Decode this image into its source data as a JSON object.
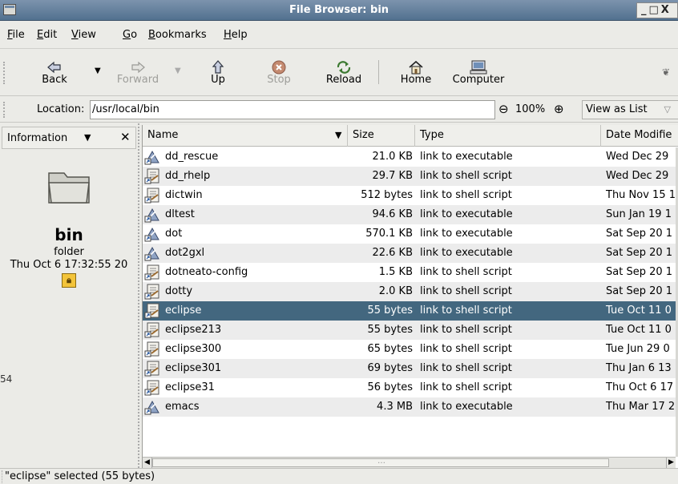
{
  "window": {
    "title": "File Browser: bin",
    "controls": "_□X"
  },
  "menu": [
    {
      "label": "File",
      "key": "F",
      "rest": "ile"
    },
    {
      "label": "Edit",
      "key": "E",
      "rest": "dit"
    },
    {
      "label": "View",
      "key": "V",
      "rest": "iew"
    },
    {
      "label": "Go",
      "key": "G",
      "rest": "o"
    },
    {
      "label": "Bookmarks",
      "key": "B",
      "rest": "ookmarks"
    },
    {
      "label": "Help",
      "key": "H",
      "rest": "elp"
    }
  ],
  "toolbar": {
    "back": {
      "label": "Back",
      "icon": "back-arrow-icon",
      "enabled": true
    },
    "forward": {
      "label": "Forward",
      "icon": "forward-arrow-icon",
      "enabled": false
    },
    "up": {
      "label": "Up",
      "icon": "up-arrow-icon",
      "enabled": true
    },
    "stop": {
      "label": "Stop",
      "icon": "stop-icon",
      "enabled": false
    },
    "reload": {
      "label": "Reload",
      "icon": "reload-icon",
      "enabled": true
    },
    "home": {
      "label": "Home",
      "icon": "home-icon",
      "enabled": true
    },
    "computer": {
      "label": "Computer",
      "icon": "computer-icon",
      "enabled": true
    }
  },
  "location": {
    "label": "Location:",
    "value": "/usr/local/bin",
    "zoom": "100%",
    "view_as": "View as List"
  },
  "side_pane": {
    "title": "Information",
    "name": "bin",
    "kind": "folder",
    "date": "Thu Oct  6 17:32:55 20",
    "stray": "54"
  },
  "columns": {
    "name": "Name",
    "size": "Size",
    "type": "Type",
    "date": "Date Modifie"
  },
  "files": [
    {
      "name": "dd_rescue",
      "size": "21.0 KB",
      "type": "link to executable",
      "date": "Wed Dec 29",
      "kind": "exec"
    },
    {
      "name": "dd_rhelp",
      "size": "29.7 KB",
      "type": "link to shell script",
      "date": "Wed Dec 29",
      "kind": "script"
    },
    {
      "name": "dictwin",
      "size": "512 bytes",
      "type": "link to shell script",
      "date": "Thu Nov 15 1",
      "kind": "script"
    },
    {
      "name": "dltest",
      "size": "94.6 KB",
      "type": "link to executable",
      "date": "Sun Jan 19 1",
      "kind": "exec"
    },
    {
      "name": "dot",
      "size": "570.1 KB",
      "type": "link to executable",
      "date": "Sat Sep 20 1",
      "kind": "exec"
    },
    {
      "name": "dot2gxl",
      "size": "22.6 KB",
      "type": "link to executable",
      "date": "Sat Sep 20 1",
      "kind": "exec"
    },
    {
      "name": "dotneato-config",
      "size": "1.5 KB",
      "type": "link to shell script",
      "date": "Sat Sep 20 1",
      "kind": "script"
    },
    {
      "name": "dotty",
      "size": "2.0 KB",
      "type": "link to shell script",
      "date": "Sat Sep 20 1",
      "kind": "script"
    },
    {
      "name": "eclipse",
      "size": "55 bytes",
      "type": "link to shell script",
      "date": "Tue Oct 11 0",
      "kind": "script",
      "selected": true
    },
    {
      "name": "eclipse213",
      "size": "55 bytes",
      "type": "link to shell script",
      "date": "Tue Oct 11 0",
      "kind": "script"
    },
    {
      "name": "eclipse300",
      "size": "65 bytes",
      "type": "link to shell script",
      "date": "Tue Jun 29 0",
      "kind": "script"
    },
    {
      "name": "eclipse301",
      "size": "69 bytes",
      "type": "link to shell script",
      "date": "Thu Jan  6 13",
      "kind": "script"
    },
    {
      "name": "eclipse31",
      "size": "56 bytes",
      "type": "link to shell script",
      "date": "Thu Oct  6 17",
      "kind": "script"
    },
    {
      "name": "emacs",
      "size": "4.3 MB",
      "type": "link to executable",
      "date": "Thu Mar 17 2",
      "kind": "exec"
    }
  ],
  "status": "\"eclipse\" selected (55 bytes)",
  "colors": {
    "title_bar": "#5d7b98",
    "selection": "#43677f",
    "stop_icon": "#b8806a"
  }
}
